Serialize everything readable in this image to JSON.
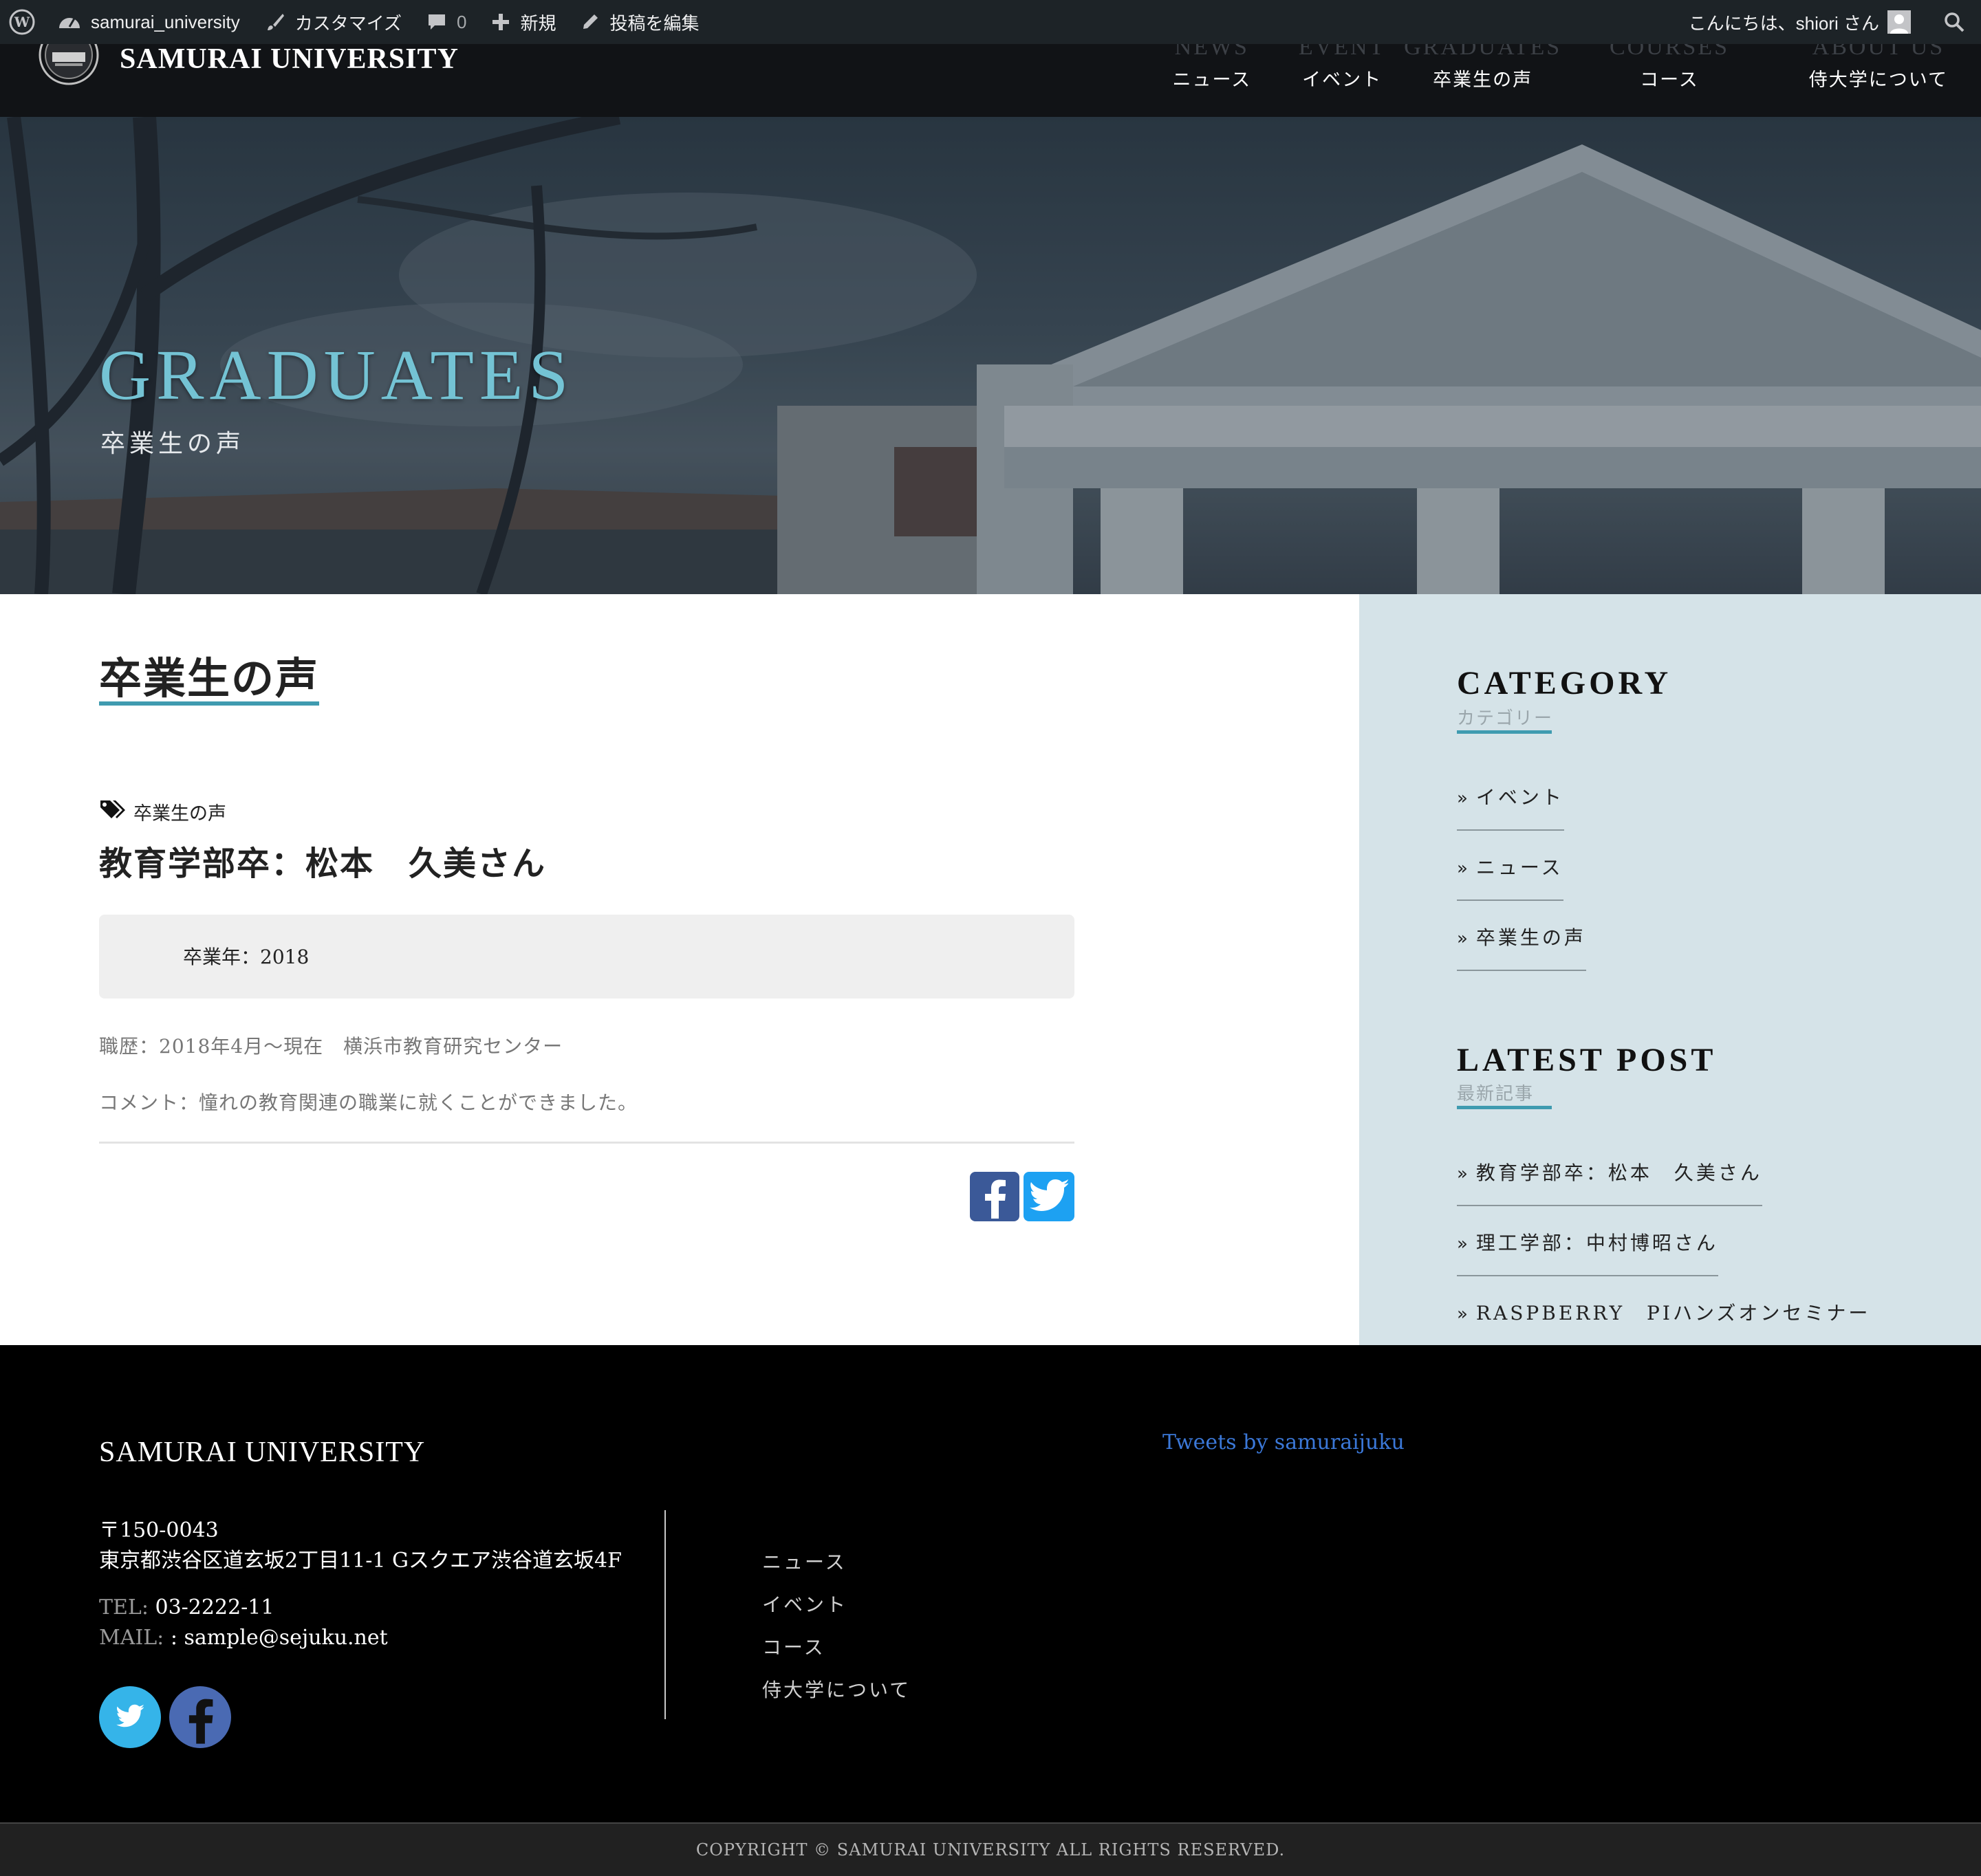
{
  "admin_bar": {
    "site_name": "samurai_university",
    "customize": "カスタマイズ",
    "comments_count": "0",
    "new": "新規",
    "edit_post": "投稿を編集",
    "greeting": "こんにちは、shiori さん"
  },
  "header": {
    "site_title": "SAMURAI UNIVERSITY",
    "nav": [
      {
        "en": "NEWS",
        "ja": "ニュース"
      },
      {
        "en": "EVENT",
        "ja": "イベント"
      },
      {
        "en": "GRADUATES",
        "ja": "卒業生の声"
      },
      {
        "en": "COURSES",
        "ja": "コース"
      },
      {
        "en": "ABOUT US",
        "ja": "侍大学について"
      }
    ]
  },
  "hero": {
    "title": "GRADUATES",
    "subtitle": "卒業生の声"
  },
  "main": {
    "heading": "卒業生の声",
    "post": {
      "category": "卒業生の声",
      "title": "教育学部卒：松本　久美さん",
      "graduation_year": "卒業年：2018",
      "career": "職歴：2018年4月〜現在　横浜市教育研究センター",
      "comment": "コメント：憧れの教育関連の職業に就くことができました。"
    }
  },
  "sidebar": {
    "category": {
      "title": "CATEGORY",
      "subtitle": "カテゴリー",
      "items": [
        "イベント",
        "ニュース",
        "卒業生の声"
      ]
    },
    "latest": {
      "title": "LATEST POST",
      "subtitle": "最新記事",
      "items": [
        "教育学部卒：松本　久美さん",
        "理工学部：中村博昭さん",
        "RASPBERRY　PIハンズオンセミナー"
      ]
    }
  },
  "footer": {
    "title": "SAMURAI UNIVERSITY",
    "zip": "〒150-0043",
    "address": "東京都渋谷区道玄坂2丁目11-1 Gスクエア渋谷道玄坂4F",
    "tel_label": "TEL:",
    "tel": "03-2222-11",
    "mail_label": "MAIL:",
    "mail": ": sample@sejuku.net",
    "nav": [
      "ニュース",
      "イベント",
      "コース",
      "侍大学について"
    ],
    "tweets_link": "Tweets by samuraijuku",
    "copyright": "COPYRIGHT © SAMURAI UNIVERSITY ALL RIGHTS RESERVED."
  },
  "colors": {
    "accent": "#3f9bb0",
    "hero_title": "#74c3d4",
    "admin_bar": "#1d2327",
    "sidebar_bg": "#d5e3e8",
    "facebook": "#3b5998",
    "twitter": "#1da1f2"
  },
  "icons": [
    "wordpress-logo-icon",
    "dashboard-icon",
    "brush-icon",
    "comment-icon",
    "plus-icon",
    "pencil-icon",
    "user-avatar-icon",
    "search-icon",
    "university-emblem-icon",
    "tag-icon",
    "facebook-icon",
    "twitter-icon"
  ]
}
